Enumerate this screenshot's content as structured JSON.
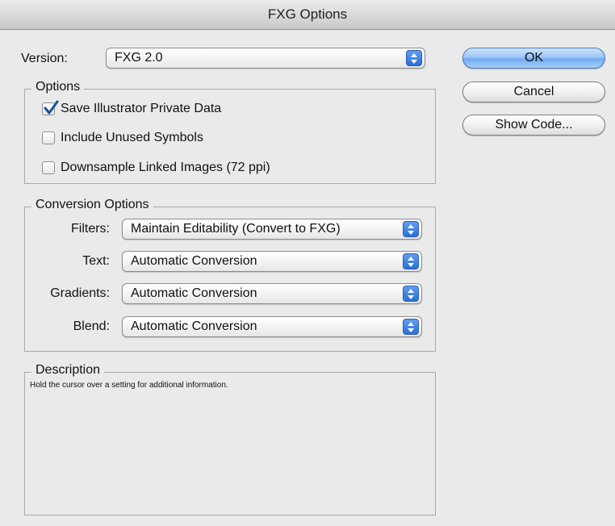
{
  "window": {
    "title": "FXG Options"
  },
  "version": {
    "label": "Version:",
    "selected": "FXG 2.0"
  },
  "buttons": {
    "ok": "OK",
    "cancel": "Cancel",
    "show_code": "Show Code..."
  },
  "options": {
    "legend": "Options",
    "items": [
      {
        "label": "Save Illustrator Private Data",
        "checked": true
      },
      {
        "label": "Include Unused Symbols",
        "checked": false
      },
      {
        "label": "Downsample Linked Images (72 ppi)",
        "checked": false
      }
    ]
  },
  "conversion": {
    "legend": "Conversion Options",
    "rows": [
      {
        "label": "Filters:",
        "selected": "Maintain Editability (Convert to FXG)"
      },
      {
        "label": "Text:",
        "selected": "Automatic Conversion"
      },
      {
        "label": "Gradients:",
        "selected": "Automatic Conversion"
      },
      {
        "label": "Blend:",
        "selected": "Automatic Conversion"
      }
    ]
  },
  "description": {
    "legend": "Description",
    "text": "Hold the cursor over a setting for additional information."
  },
  "icons": {
    "popup": "updown-arrows-icon",
    "check": "checkmark-icon"
  },
  "colors": {
    "accent": "#2a6fd4",
    "default_button": "#9cc6f6"
  }
}
